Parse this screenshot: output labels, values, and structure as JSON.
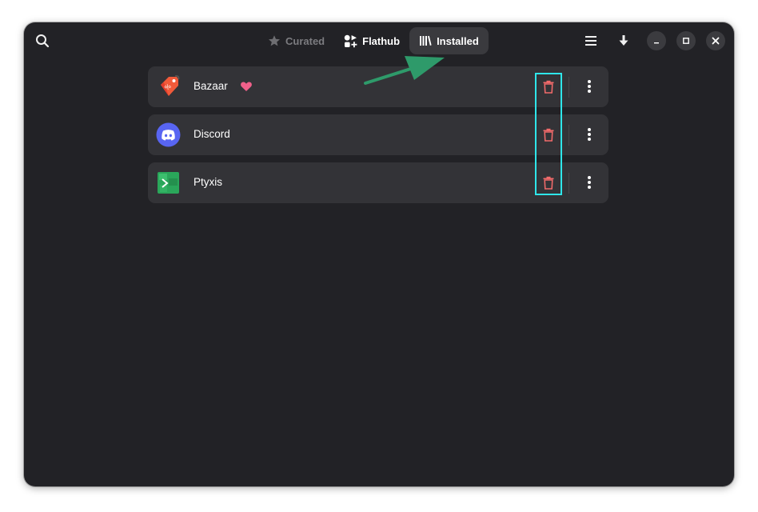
{
  "header": {
    "tabs": [
      {
        "label": "Curated",
        "icon": "star-icon",
        "state": "inactive"
      },
      {
        "label": "Flathub",
        "icon": "flathub-icon",
        "state": "normal"
      },
      {
        "label": "Installed",
        "icon": "library-icon",
        "state": "selected"
      }
    ],
    "actions": [
      "search-icon",
      "hamburger-menu-icon",
      "download-icon"
    ],
    "window_controls": [
      "minimize-icon",
      "maximize-icon",
      "close-icon"
    ]
  },
  "installed_apps": [
    {
      "name": "Bazaar",
      "icon": "bazaar-tag-icon",
      "favorite": true
    },
    {
      "name": "Discord",
      "icon": "discord-icon",
      "favorite": false
    },
    {
      "name": "Ptyxis",
      "icon": "ptyxis-terminal-icon",
      "favorite": false
    }
  ],
  "colors": {
    "window_bg": "#222226",
    "row_bg": "#333337",
    "trash": "#f06a6a",
    "heart": "#f0608a",
    "highlight": "#2ee6ea",
    "arrow": "#2e9a6a"
  }
}
